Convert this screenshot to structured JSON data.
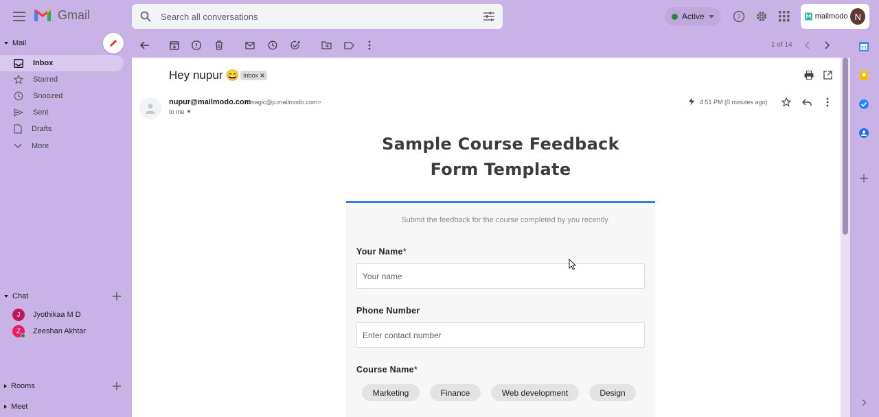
{
  "app": {
    "name": "Gmail"
  },
  "search": {
    "placeholder": "Search all conversations"
  },
  "status": {
    "label": "Active"
  },
  "brand": {
    "name": "mailmodo",
    "avatar_initial": "N"
  },
  "sidebar": {
    "mail_header": "Mail",
    "items": [
      {
        "label": "Inbox"
      },
      {
        "label": "Starred"
      },
      {
        "label": "Snoozed"
      },
      {
        "label": "Sent"
      },
      {
        "label": "Drafts"
      },
      {
        "label": "More"
      }
    ],
    "chat_header": "Chat",
    "chat_people": [
      {
        "name": "Jyothikaa M D",
        "initial": "J",
        "color": "#c2185b"
      },
      {
        "name": "Zeeshan Akhtar",
        "initial": "Z",
        "color": "#e91e63"
      }
    ],
    "rooms_header": "Rooms",
    "meet_header": "Meet"
  },
  "toolbar": {
    "pager": "1 of 14"
  },
  "email": {
    "subject": "Hey nupur",
    "subject_emoji": "😄",
    "label_tag": "Inbox",
    "sender_name": "nupur@mailmodo.com",
    "sender_email": "<magic@p.mailmodo.com>",
    "to": "to me",
    "timestamp": "4:51 PM (0 minutes ago)"
  },
  "form": {
    "title_line1": "Sample Course Feedback",
    "title_line2": "Form Template",
    "subtitle": "Submit the feedback for the course completed by you recently",
    "name_label": "Your Name",
    "name_required": "*",
    "name_placeholder": "Your name",
    "phone_label": "Phone Number",
    "phone_placeholder": "Enter contact number",
    "course_label": "Course Name",
    "course_required": "*",
    "courses": [
      "Marketing",
      "Finance",
      "Web development",
      "Design"
    ]
  },
  "colors": {
    "accent": "#2f7fe0",
    "background": "#c9b3e6",
    "active_green": "#1e8e3e"
  }
}
